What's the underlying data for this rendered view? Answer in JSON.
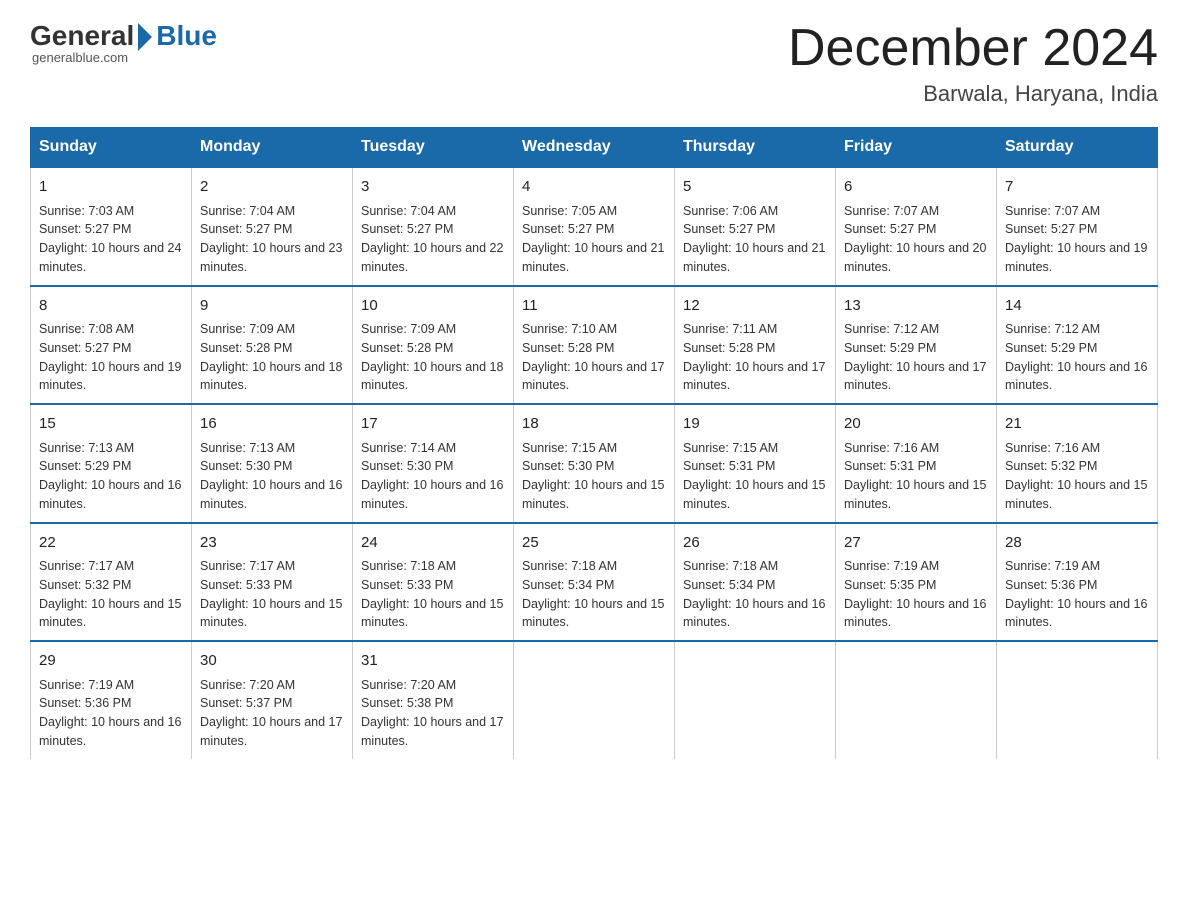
{
  "header": {
    "logo_general": "General",
    "logo_blue": "Blue",
    "logo_sub": "generalblue.com",
    "main_title": "December 2024",
    "subtitle": "Barwala, Haryana, India"
  },
  "days_of_week": [
    "Sunday",
    "Monday",
    "Tuesday",
    "Wednesday",
    "Thursday",
    "Friday",
    "Saturday"
  ],
  "weeks": [
    [
      {
        "day": "1",
        "sunrise": "7:03 AM",
        "sunset": "5:27 PM",
        "daylight": "10 hours and 24 minutes."
      },
      {
        "day": "2",
        "sunrise": "7:04 AM",
        "sunset": "5:27 PM",
        "daylight": "10 hours and 23 minutes."
      },
      {
        "day": "3",
        "sunrise": "7:04 AM",
        "sunset": "5:27 PM",
        "daylight": "10 hours and 22 minutes."
      },
      {
        "day": "4",
        "sunrise": "7:05 AM",
        "sunset": "5:27 PM",
        "daylight": "10 hours and 21 minutes."
      },
      {
        "day": "5",
        "sunrise": "7:06 AM",
        "sunset": "5:27 PM",
        "daylight": "10 hours and 21 minutes."
      },
      {
        "day": "6",
        "sunrise": "7:07 AM",
        "sunset": "5:27 PM",
        "daylight": "10 hours and 20 minutes."
      },
      {
        "day": "7",
        "sunrise": "7:07 AM",
        "sunset": "5:27 PM",
        "daylight": "10 hours and 19 minutes."
      }
    ],
    [
      {
        "day": "8",
        "sunrise": "7:08 AM",
        "sunset": "5:27 PM",
        "daylight": "10 hours and 19 minutes."
      },
      {
        "day": "9",
        "sunrise": "7:09 AM",
        "sunset": "5:28 PM",
        "daylight": "10 hours and 18 minutes."
      },
      {
        "day": "10",
        "sunrise": "7:09 AM",
        "sunset": "5:28 PM",
        "daylight": "10 hours and 18 minutes."
      },
      {
        "day": "11",
        "sunrise": "7:10 AM",
        "sunset": "5:28 PM",
        "daylight": "10 hours and 17 minutes."
      },
      {
        "day": "12",
        "sunrise": "7:11 AM",
        "sunset": "5:28 PM",
        "daylight": "10 hours and 17 minutes."
      },
      {
        "day": "13",
        "sunrise": "7:12 AM",
        "sunset": "5:29 PM",
        "daylight": "10 hours and 17 minutes."
      },
      {
        "day": "14",
        "sunrise": "7:12 AM",
        "sunset": "5:29 PM",
        "daylight": "10 hours and 16 minutes."
      }
    ],
    [
      {
        "day": "15",
        "sunrise": "7:13 AM",
        "sunset": "5:29 PM",
        "daylight": "10 hours and 16 minutes."
      },
      {
        "day": "16",
        "sunrise": "7:13 AM",
        "sunset": "5:30 PM",
        "daylight": "10 hours and 16 minutes."
      },
      {
        "day": "17",
        "sunrise": "7:14 AM",
        "sunset": "5:30 PM",
        "daylight": "10 hours and 16 minutes."
      },
      {
        "day": "18",
        "sunrise": "7:15 AM",
        "sunset": "5:30 PM",
        "daylight": "10 hours and 15 minutes."
      },
      {
        "day": "19",
        "sunrise": "7:15 AM",
        "sunset": "5:31 PM",
        "daylight": "10 hours and 15 minutes."
      },
      {
        "day": "20",
        "sunrise": "7:16 AM",
        "sunset": "5:31 PM",
        "daylight": "10 hours and 15 minutes."
      },
      {
        "day": "21",
        "sunrise": "7:16 AM",
        "sunset": "5:32 PM",
        "daylight": "10 hours and 15 minutes."
      }
    ],
    [
      {
        "day": "22",
        "sunrise": "7:17 AM",
        "sunset": "5:32 PM",
        "daylight": "10 hours and 15 minutes."
      },
      {
        "day": "23",
        "sunrise": "7:17 AM",
        "sunset": "5:33 PM",
        "daylight": "10 hours and 15 minutes."
      },
      {
        "day": "24",
        "sunrise": "7:18 AM",
        "sunset": "5:33 PM",
        "daylight": "10 hours and 15 minutes."
      },
      {
        "day": "25",
        "sunrise": "7:18 AM",
        "sunset": "5:34 PM",
        "daylight": "10 hours and 15 minutes."
      },
      {
        "day": "26",
        "sunrise": "7:18 AM",
        "sunset": "5:34 PM",
        "daylight": "10 hours and 16 minutes."
      },
      {
        "day": "27",
        "sunrise": "7:19 AM",
        "sunset": "5:35 PM",
        "daylight": "10 hours and 16 minutes."
      },
      {
        "day": "28",
        "sunrise": "7:19 AM",
        "sunset": "5:36 PM",
        "daylight": "10 hours and 16 minutes."
      }
    ],
    [
      {
        "day": "29",
        "sunrise": "7:19 AM",
        "sunset": "5:36 PM",
        "daylight": "10 hours and 16 minutes."
      },
      {
        "day": "30",
        "sunrise": "7:20 AM",
        "sunset": "5:37 PM",
        "daylight": "10 hours and 17 minutes."
      },
      {
        "day": "31",
        "sunrise": "7:20 AM",
        "sunset": "5:38 PM",
        "daylight": "10 hours and 17 minutes."
      },
      {
        "day": "",
        "sunrise": "",
        "sunset": "",
        "daylight": ""
      },
      {
        "day": "",
        "sunrise": "",
        "sunset": "",
        "daylight": ""
      },
      {
        "day": "",
        "sunrise": "",
        "sunset": "",
        "daylight": ""
      },
      {
        "day": "",
        "sunrise": "",
        "sunset": "",
        "daylight": ""
      }
    ]
  ]
}
